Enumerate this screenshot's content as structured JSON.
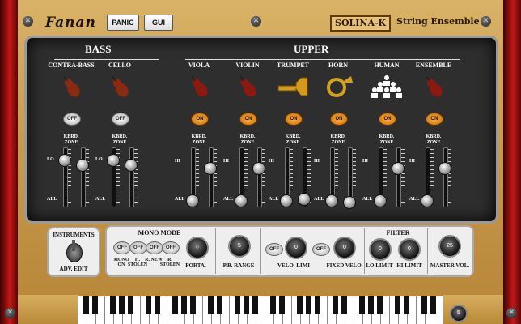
{
  "app": {
    "logo": "Fanan",
    "panic_label": "PANIC",
    "gui_label": "GUI",
    "brand1": "SOLINA-K",
    "brand2": "String Ensemble"
  },
  "bass": {
    "title": "BASS",
    "instruments": [
      {
        "name": "CONTRA-BASS",
        "state": "OFF",
        "zone": "KBRD.\nZONE"
      },
      {
        "name": "CELLO",
        "state": "OFF",
        "zone": "KBRD.\nZONE"
      }
    ]
  },
  "upper": {
    "title": "UPPER",
    "instruments": [
      {
        "name": "VIOLA",
        "state": "ON",
        "zone": "KBRD.\nZONE"
      },
      {
        "name": "VIOLIN",
        "state": "ON",
        "zone": "KBRD.\nZONE"
      },
      {
        "name": "TRUMPET",
        "state": "ON",
        "zone": "KBRD.\nZONE"
      },
      {
        "name": "HORN",
        "state": "ON",
        "zone": "KBRD.\nZONE"
      },
      {
        "name": "HUMAN",
        "state": "ON",
        "zone": "KBRD.\nZONE"
      },
      {
        "name": "ENSEMBLE",
        "state": "ON",
        "zone": "KBRD.\nZONE"
      }
    ]
  },
  "fader_labels": {
    "lo": "LO",
    "hi": "HI",
    "all": "ALL"
  },
  "instruments_box": {
    "title": "INSTRUMENTS",
    "adv": "ADV. EDIT"
  },
  "bottom": {
    "mono_mode_title": "MONO MODE",
    "mono_toggles": [
      {
        "state": "OFF",
        "label": "MONO ON"
      },
      {
        "state": "OFF",
        "label": "H. STOLEN"
      },
      {
        "state": "OFF",
        "label": "R. NEW"
      },
      {
        "state": "OFF",
        "label": "R. STOLEN"
      }
    ],
    "porta": "PORTA.",
    "pb_range": "P.B. RANGE",
    "pb_value": "5",
    "velo_toggle": "OFF",
    "velo_limi_value": "0",
    "velo_limi": "VELO. LIMI",
    "fixed_toggle": "OFF",
    "fixed_value": "0",
    "fixed_velo": "FIXED VELO.",
    "filter_title": "FILTER",
    "lo_limit_value": "0",
    "lo_limit": "LO LIMIT",
    "hi_limit_value": "0",
    "hi_limit": "HI LIMIT",
    "master_value": "25",
    "master": "MASTER VOL."
  },
  "transpose_value": "5"
}
